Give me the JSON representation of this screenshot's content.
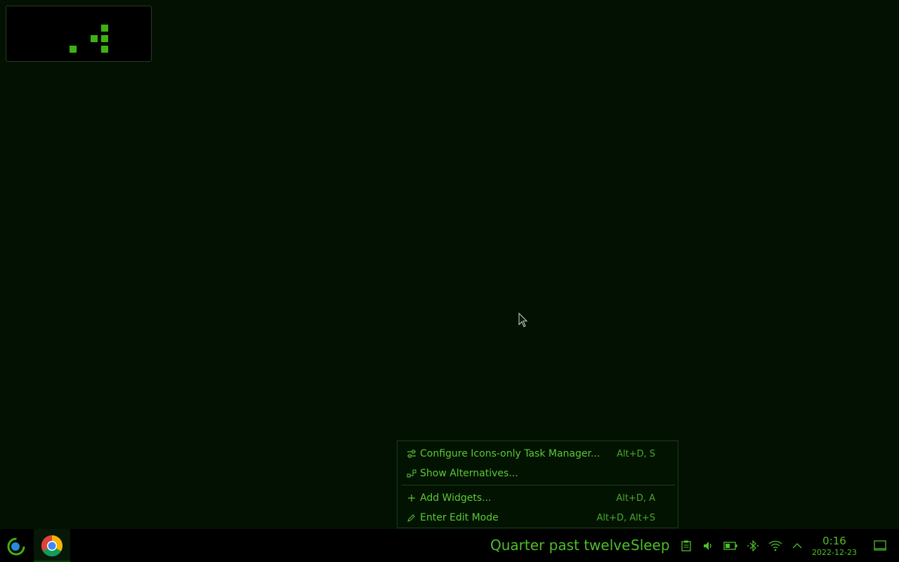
{
  "menu": {
    "items": [
      {
        "icon": "configure-icon",
        "label": "Configure Icons-only Task Manager...",
        "shortcut": "Alt+D, S"
      },
      {
        "icon": "alternatives-icon",
        "label": "Show Alternatives...",
        "shortcut": ""
      },
      {
        "icon": "add-icon",
        "label": "Add Widgets...",
        "shortcut": "Alt+D, A"
      },
      {
        "icon": "edit-icon",
        "label": "Enter Edit Mode",
        "shortcut": "Alt+D, Alt+S"
      }
    ]
  },
  "taskbar": {
    "launcher_icon": "app-launcher-icon",
    "tasks": [
      {
        "icon": "chrome-icon"
      }
    ],
    "fuzzy_clock": "Quarter past twelve",
    "sleep_label": "Sleep",
    "tray": [
      "clipboard-icon",
      "volume-icon",
      "battery-icon",
      "bluetooth-icon",
      "wifi-icon",
      "expand-tray-icon"
    ],
    "time": "0:16",
    "date": "2022-12-23",
    "show_desktop_icon": "show-desktop-icon"
  },
  "colors": {
    "background": "#021102",
    "accent": "#4fbf2a",
    "panel": "#000000"
  }
}
